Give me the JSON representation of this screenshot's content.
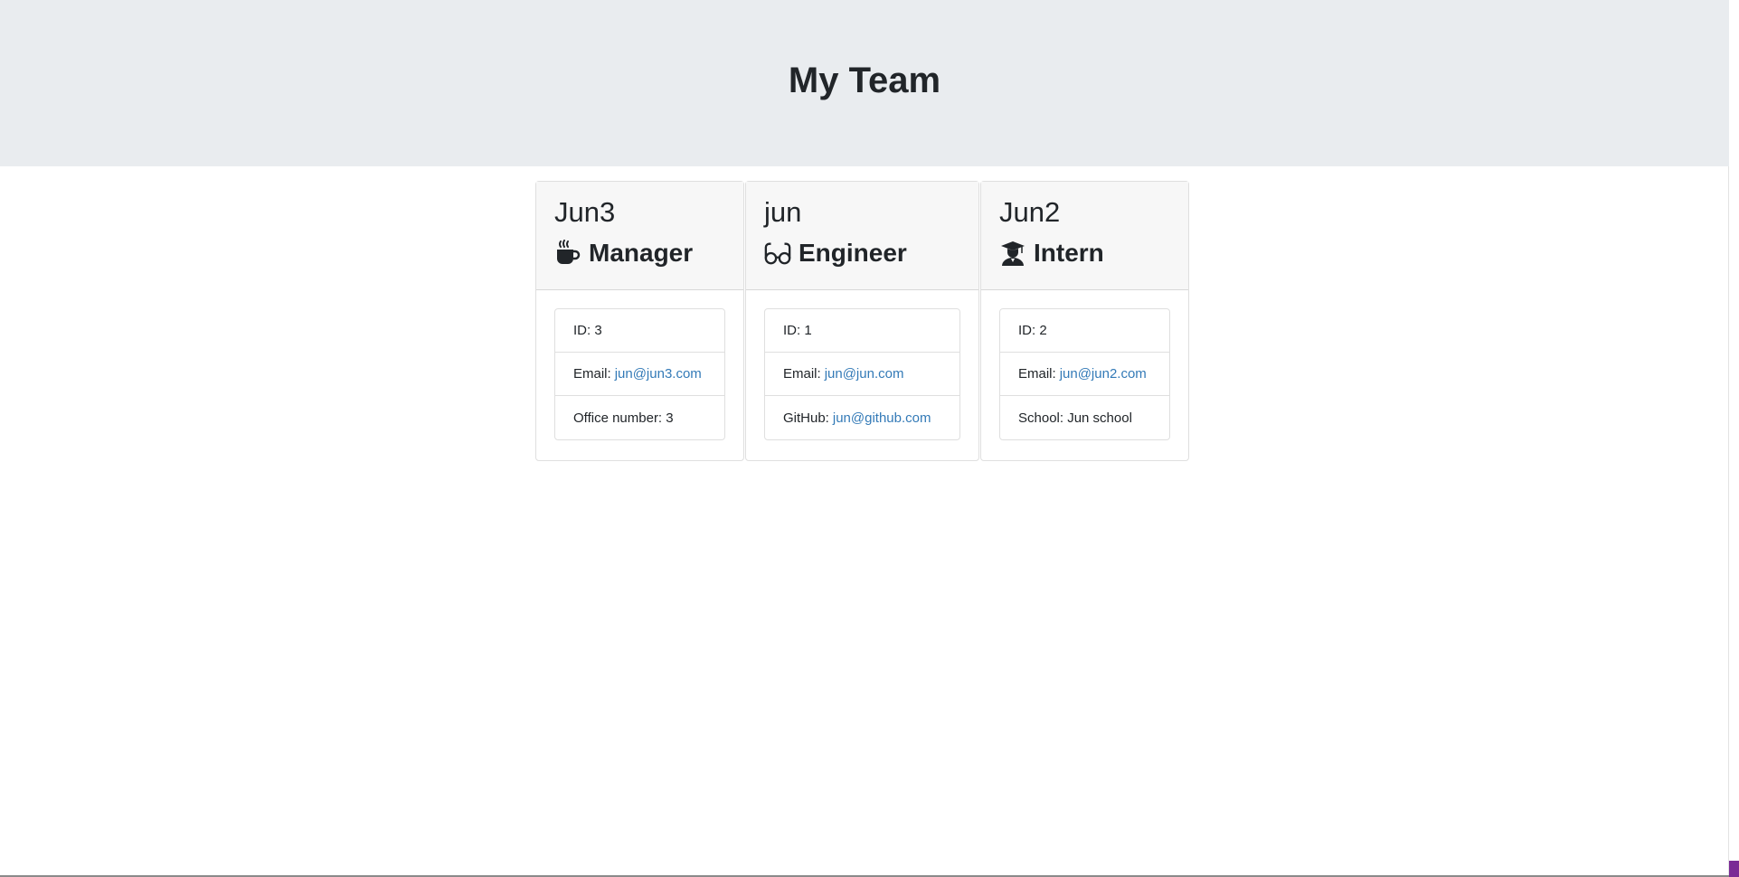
{
  "header": {
    "title": "My Team"
  },
  "employees": [
    {
      "name": "Jun3",
      "role": "Manager",
      "role_icon": "coffee-mug-icon",
      "id_label": "ID: 3",
      "email_label": "Email:",
      "email": "jun@jun3.com",
      "extra_label": "Office number: 3",
      "extra_link": ""
    },
    {
      "name": "jun",
      "role": "Engineer",
      "role_icon": "glasses-icon",
      "id_label": "ID: 1",
      "email_label": "Email:",
      "email": "jun@jun.com",
      "extra_label": "GitHub:",
      "extra_link": "jun@github.com"
    },
    {
      "name": "Jun2",
      "role": "Intern",
      "role_icon": "graduate-icon",
      "id_label": "ID: 2",
      "email_label": "Email:",
      "email": "jun@jun2.com",
      "extra_label": "School: Jun school",
      "extra_link": ""
    }
  ],
  "colors": {
    "link": "#337ab7",
    "header_bg": "#e9ecef",
    "card_header_bg": "#f7f7f7",
    "scrollbar_thumb": "#7a2a95"
  }
}
